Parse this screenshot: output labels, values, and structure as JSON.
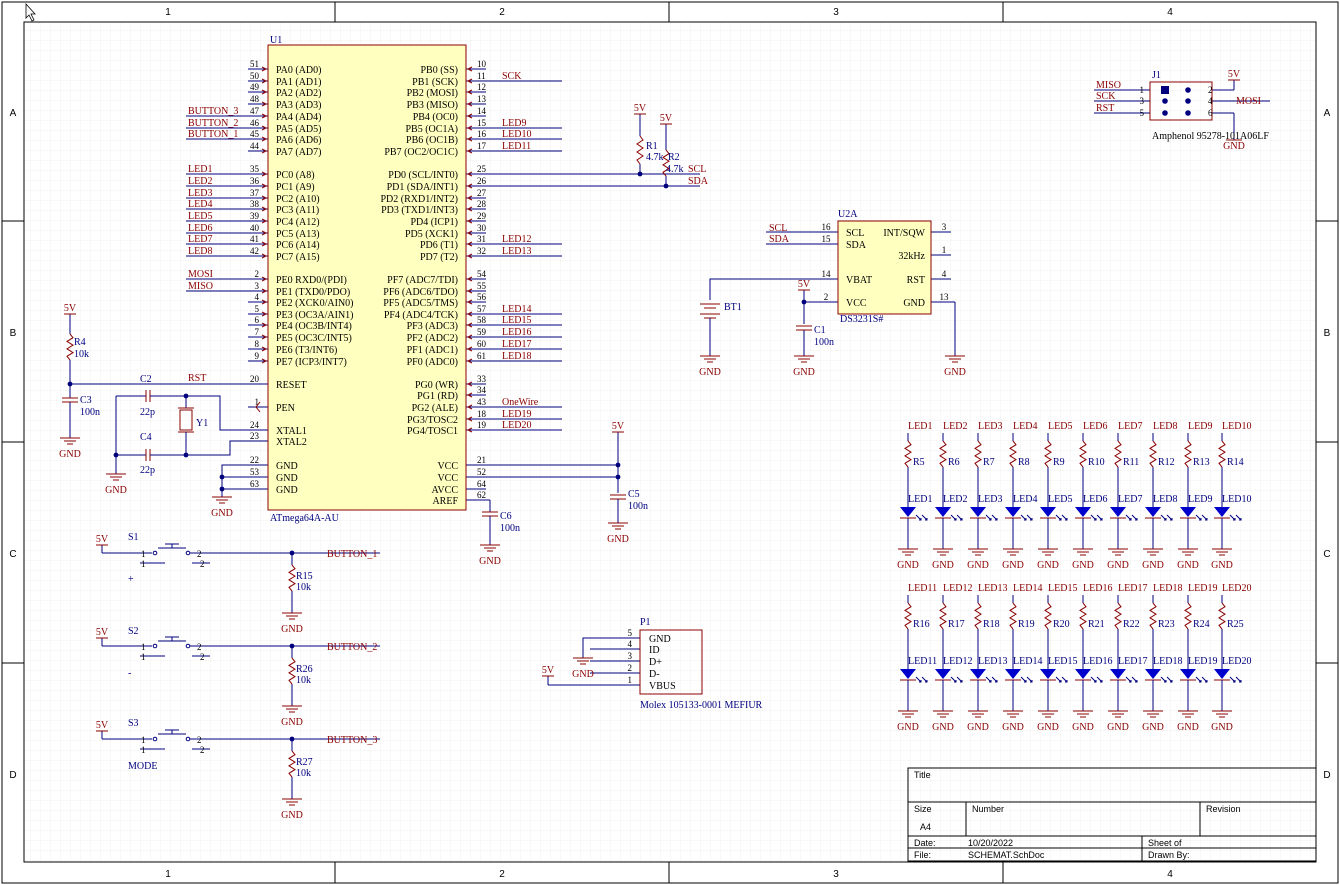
{
  "border": {
    "cols": [
      "1",
      "2",
      "3",
      "4"
    ],
    "rows": [
      "A",
      "B",
      "C",
      "D"
    ]
  },
  "u1": {
    "ref": "U1",
    "name": "ATmega64A-AU",
    "left": [
      {
        "n": "51",
        "l": "PA0 (AD0)",
        "net": ""
      },
      {
        "n": "50",
        "l": "PA1 (AD1)",
        "net": ""
      },
      {
        "n": "49",
        "l": "PA2 (AD2)",
        "net": ""
      },
      {
        "n": "48",
        "l": "PA3 (AD3)",
        "net": ""
      },
      {
        "n": "47",
        "l": "PA4 (AD4)",
        "net": "BUTTON_3"
      },
      {
        "n": "46",
        "l": "PA5 (AD5)",
        "net": "BUTTON_2"
      },
      {
        "n": "45",
        "l": "PA6 (AD6)",
        "net": "BUTTON_1"
      },
      {
        "n": "44",
        "l": "PA7 (AD7)",
        "net": ""
      },
      {
        "n": "35",
        "l": "PC0 (A8)",
        "net": "LED1"
      },
      {
        "n": "36",
        "l": "PC1 (A9)",
        "net": "LED2"
      },
      {
        "n": "37",
        "l": "PC2 (A10)",
        "net": "LED3"
      },
      {
        "n": "38",
        "l": "PC3 (A11)",
        "net": "LED4"
      },
      {
        "n": "39",
        "l": "PC4 (A12)",
        "net": "LED5"
      },
      {
        "n": "40",
        "l": "PC5 (A13)",
        "net": "LED6"
      },
      {
        "n": "41",
        "l": "PC6 (A14)",
        "net": "LED7"
      },
      {
        "n": "42",
        "l": "PC7 (A15)",
        "net": "LED8"
      },
      {
        "n": "2",
        "l": "PE0 RXD0/(PDI)",
        "net": "MOSI"
      },
      {
        "n": "3",
        "l": "PE1 (TXD0/PDO)",
        "net": "MISO"
      },
      {
        "n": "4",
        "l": "PE2 (XCK0/AIN0)",
        "net": ""
      },
      {
        "n": "5",
        "l": "PE3 (OC3A/AIN1)",
        "net": ""
      },
      {
        "n": "6",
        "l": "PE4 (OC3B/INT4)",
        "net": ""
      },
      {
        "n": "7",
        "l": "PE5 (OC3C/INT5)",
        "net": ""
      },
      {
        "n": "8",
        "l": "PE6 (T3/INT6)",
        "net": ""
      },
      {
        "n": "9",
        "l": "PE7 (ICP3/INT7)",
        "net": ""
      },
      {
        "n": "20",
        "l": "RESET",
        "net": "RST"
      },
      {
        "n": "1",
        "l": "PEN",
        "net": ""
      },
      {
        "n": "24",
        "l": "XTAL1",
        "net": ""
      },
      {
        "n": "23",
        "l": "XTAL2",
        "net": ""
      },
      {
        "n": "22",
        "l": "GND",
        "net": ""
      },
      {
        "n": "53",
        "l": "GND",
        "net": ""
      },
      {
        "n": "63",
        "l": "GND",
        "net": ""
      }
    ],
    "right": [
      {
        "n": "10",
        "l": "PB0 (SS)",
        "net": ""
      },
      {
        "n": "11",
        "l": "PB1 (SCK)",
        "net": "SCK"
      },
      {
        "n": "12",
        "l": "PB2 (MOSI)",
        "net": ""
      },
      {
        "n": "13",
        "l": "PB3 (MISO)",
        "net": ""
      },
      {
        "n": "14",
        "l": "PB4 (OC0)",
        "net": ""
      },
      {
        "n": "15",
        "l": "PB5 (OC1A)",
        "net": "LED9"
      },
      {
        "n": "16",
        "l": "PB6 (OC1B)",
        "net": "LED10"
      },
      {
        "n": "17",
        "l": "PB7 (OC2/OC1C)",
        "net": "LED11"
      },
      {
        "n": "25",
        "l": "PD0 (SCL/INT0)",
        "net": ""
      },
      {
        "n": "26",
        "l": "PD1 (SDA/INT1)",
        "net": ""
      },
      {
        "n": "27",
        "l": "PD2 (RXD1/INT2)",
        "net": ""
      },
      {
        "n": "28",
        "l": "PD3 (TXD1/INT3)",
        "net": ""
      },
      {
        "n": "29",
        "l": "PD4 (ICP1)",
        "net": ""
      },
      {
        "n": "30",
        "l": "PD5 (XCK1)",
        "net": ""
      },
      {
        "n": "31",
        "l": "PD6 (T1)",
        "net": "LED12"
      },
      {
        "n": "32",
        "l": "PD7 (T2)",
        "net": "LED13"
      },
      {
        "n": "54",
        "l": "PF7 (ADC7/TDI)",
        "net": ""
      },
      {
        "n": "55",
        "l": "PF6 (ADC6/TDO)",
        "net": ""
      },
      {
        "n": "56",
        "l": "PF5 (ADC5/TMS)",
        "net": ""
      },
      {
        "n": "57",
        "l": "PF4 (ADC4/TCK)",
        "net": "LED14"
      },
      {
        "n": "58",
        "l": "PF3 (ADC3)",
        "net": "LED15"
      },
      {
        "n": "59",
        "l": "PF2 (ADC2)",
        "net": "LED16"
      },
      {
        "n": "60",
        "l": "PF1 (ADC1)",
        "net": "LED17"
      },
      {
        "n": "61",
        "l": "PF0 (ADC0)",
        "net": "LED18"
      },
      {
        "n": "33",
        "l": "PG0 (WR)",
        "net": ""
      },
      {
        "n": "34",
        "l": "PG1 (RD)",
        "net": ""
      },
      {
        "n": "43",
        "l": "PG2 (ALE)",
        "net": "OneWire"
      },
      {
        "n": "18",
        "l": "PG3/TOSC2",
        "net": "LED19"
      },
      {
        "n": "19",
        "l": "PG4/TOSC1",
        "net": "LED20"
      },
      {
        "n": "21",
        "l": "VCC",
        "net": ""
      },
      {
        "n": "52",
        "l": "VCC",
        "net": ""
      },
      {
        "n": "64",
        "l": "AVCC",
        "net": ""
      },
      {
        "n": "62",
        "l": "AREF",
        "net": ""
      }
    ]
  },
  "u2": {
    "ref": "U2A",
    "name": "DS3231S#",
    "pins": [
      {
        "n": "16",
        "l": "SCL",
        "net": "SCL"
      },
      {
        "n": "15",
        "l": "SDA",
        "net": "SDA"
      },
      {
        "n": "14",
        "l": "VBAT",
        "net": ""
      },
      {
        "n": "2",
        "l": "VCC",
        "net": ""
      },
      {
        "n": "3",
        "l": "INT/SQW",
        "net": ""
      },
      {
        "n": "1",
        "l": "32kHz",
        "net": ""
      },
      {
        "n": "4",
        "l": "RST",
        "net": ""
      },
      {
        "n": "13",
        "l": "GND",
        "net": ""
      }
    ]
  },
  "j1": {
    "ref": "J1",
    "name": "Amphenol 95278-101A06LF",
    "left": [
      "MISO",
      "SCK",
      "RST"
    ],
    "leftpins": [
      "1",
      "3",
      "5"
    ],
    "rightpins": [
      "2",
      "4",
      "6"
    ],
    "right": [
      "5V",
      "MOSI",
      "GND"
    ]
  },
  "p1": {
    "ref": "P1",
    "name": "Molex 105133-0001 MEFIUR",
    "pins": [
      "5",
      "4",
      "3",
      "2",
      "1"
    ],
    "labels": [
      "GND",
      "ID",
      "D+",
      "D-",
      "VBUS"
    ]
  },
  "parts": {
    "r1": {
      "ref": "R1",
      "val": "4.7k"
    },
    "r2": {
      "ref": "R2",
      "val": "4.7k"
    },
    "r4": {
      "ref": "R4",
      "val": "10k"
    },
    "c1": {
      "ref": "C1",
      "val": "100n"
    },
    "c2": {
      "ref": "C2",
      "val": "22p"
    },
    "c3": {
      "ref": "C3",
      "val": "100n"
    },
    "c4": {
      "ref": "C4",
      "val": "22p"
    },
    "c5": {
      "ref": "C5",
      "val": "100n"
    },
    "c6": {
      "ref": "C6",
      "val": "100n"
    },
    "y1": {
      "ref": "Y1"
    },
    "bt1": {
      "ref": "BT1"
    },
    "r15": {
      "ref": "R15",
      "val": "10k"
    },
    "r26": {
      "ref": "R26",
      "val": "10k"
    },
    "r27": {
      "ref": "R27",
      "val": "10k"
    },
    "s1": {
      "ref": "S1",
      "label": "+",
      "net": "BUTTON_1"
    },
    "s2": {
      "ref": "S2",
      "label": "-",
      "net": "BUTTON_2"
    },
    "s3": {
      "ref": "S3",
      "label": "MODE",
      "net": "BUTTON_3"
    }
  },
  "leds_top": {
    "nets": [
      "LED1",
      "LED2",
      "LED3",
      "LED4",
      "LED5",
      "LED6",
      "LED7",
      "LED8",
      "LED9",
      "LED10"
    ],
    "res": [
      "R5",
      "R6",
      "R7",
      "R8",
      "R9",
      "R10",
      "R11",
      "R12",
      "R13",
      "R14"
    ]
  },
  "leds_bot": {
    "nets": [
      "LED11",
      "LED12",
      "LED13",
      "LED14",
      "LED15",
      "LED16",
      "LED17",
      "LED18",
      "LED19",
      "LED20"
    ],
    "res": [
      "R16",
      "R17",
      "R18",
      "R19",
      "R20",
      "R21",
      "R22",
      "R23",
      "R24",
      "R25"
    ]
  },
  "labels": {
    "gnd": "GND",
    "v5": "5V",
    "scl": "SCL",
    "sda": "SDA",
    "rst": "RST",
    "pin1": "1",
    "pin2": "2"
  },
  "titleblock": {
    "title": "Title",
    "size_label": "Size",
    "size": "A4",
    "number_label": "Number",
    "revision_label": "Revision",
    "date_label": "Date:",
    "date": "10/20/2022",
    "file_label": "File:",
    "file": "SCHEMAT.SchDoc",
    "sheet": "Sheet    of",
    "drawn": "Drawn By:"
  }
}
